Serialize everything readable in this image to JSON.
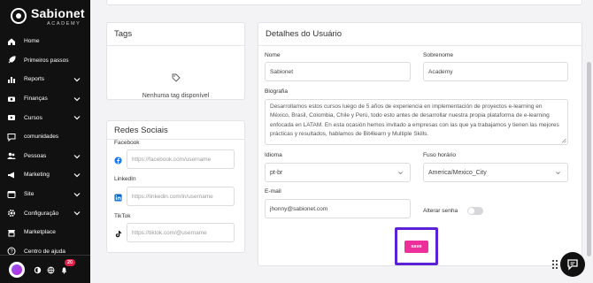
{
  "brand": {
    "name": "Sabionet",
    "subtitle": "ACADEMY"
  },
  "sidebar": {
    "items": [
      {
        "label": "Home",
        "icon": "home-icon",
        "chevron": false
      },
      {
        "label": "Primeiros passos",
        "icon": "rocket-icon",
        "chevron": false
      },
      {
        "label": "Reports",
        "icon": "reports-icon",
        "chevron": true
      },
      {
        "label": "Finanças",
        "icon": "finance-icon",
        "chevron": true
      },
      {
        "label": "Cursos",
        "icon": "courses-icon",
        "chevron": true
      },
      {
        "label": "comunidades",
        "icon": "chat-icon",
        "chevron": false
      },
      {
        "label": "Pessoas",
        "icon": "people-icon",
        "chevron": true
      },
      {
        "label": "Marketing",
        "icon": "marketing-icon",
        "chevron": true
      },
      {
        "label": "Site",
        "icon": "site-icon",
        "chevron": true
      },
      {
        "label": "Configuração",
        "icon": "settings-icon",
        "chevron": true
      },
      {
        "label": "Marketplace",
        "icon": "marketplace-icon",
        "chevron": false
      },
      {
        "label": "Centro de ajuda",
        "icon": "help-icon",
        "chevron": false
      }
    ],
    "notification_count": "20"
  },
  "tags": {
    "title": "Tags",
    "empty_text": "Nenhuma tag disponível"
  },
  "social": {
    "title": "Redes Sociais",
    "facebook": {
      "label": "Facebook",
      "placeholder": "https://facebook.com/username"
    },
    "linkedin": {
      "label": "LinkedIn",
      "placeholder": "https://linkedin.com/in/username"
    },
    "tiktok": {
      "label": "TikTok",
      "placeholder": "https://tiktok.com/@username"
    }
  },
  "user_details": {
    "title": "Detalhes do Usuário",
    "name_label": "Nome",
    "name_value": "Sabionet",
    "surname_label": "Sobrenome",
    "surname_value": "Academy",
    "bio_label": "Biografia",
    "bio_value": "Desarrollamos estos cursos luego de  5 años de experiencia en implementación de proyectos e-learning en México, Brasil, Colombia, Chile y Perú, todo esto antes de desarrollar nuestra propia plataforma de e-learning enfocada en LATAM. En esta ocasión hemos invitado a empresas con las que ya trabajamos y tienen las mejores prácticas y resultados, hablamos de Bit4learn y Multiple Skills.",
    "language_label": "Idioma",
    "language_value": "pt-br",
    "timezone_label": "Fuso horário",
    "timezone_value": "America/Mexico_City",
    "email_label": "E-mail",
    "email_value": "jhonny@sabionet.com",
    "password_label": "Alterar senha",
    "password_toggle_on": false,
    "save_label": "save"
  },
  "colors": {
    "sidebar_bg": "#111111",
    "accent_pink": "#ec2f9a",
    "highlight_purple": "#5b21d6"
  }
}
